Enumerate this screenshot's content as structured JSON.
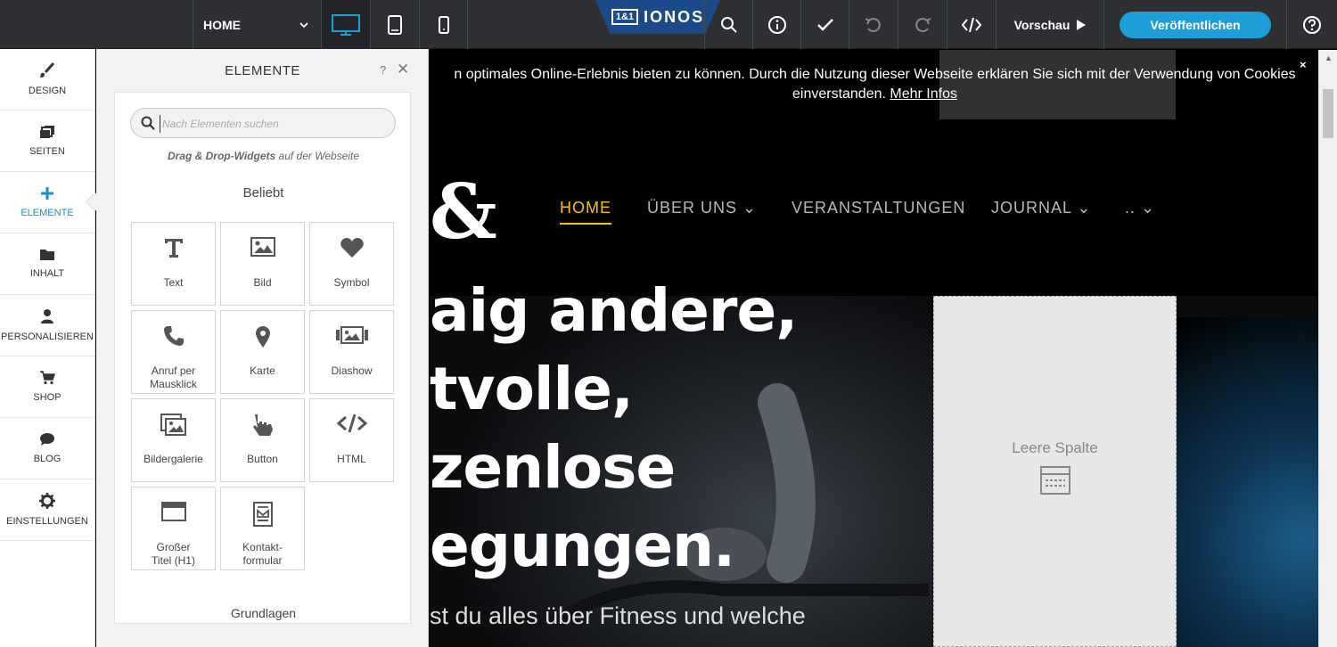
{
  "toolbar": {
    "page_select": "HOME",
    "logo_box": "1&1",
    "logo_text": "IONOS",
    "preview_label": "Vorschau",
    "publish_label": "Veröffentlichen",
    "accent": "#1e9ed6"
  },
  "leftnav": {
    "items": [
      {
        "label": "DESIGN",
        "icon": "brush-icon"
      },
      {
        "label": "SEITEN",
        "icon": "pages-icon"
      },
      {
        "label": "ELEMENTE",
        "icon": "plus-icon",
        "active": true
      },
      {
        "label": "INHALT",
        "icon": "folder-icon"
      },
      {
        "label": "PERSONALISIEREN",
        "icon": "person-icon"
      },
      {
        "label": "SHOP",
        "icon": "cart-icon"
      },
      {
        "label": "BLOG",
        "icon": "comment-icon"
      },
      {
        "label": "EINSTELLUNGEN",
        "icon": "gear-icon"
      }
    ]
  },
  "panel": {
    "title": "ELEMENTE",
    "help": "?",
    "search_placeholder": "Nach Elementen suchen",
    "hint_bold": "Drag & Drop-Widgets",
    "hint_rest": " auf der Webseite",
    "section_popular": "Beliebt",
    "section_basics": "Grundlagen",
    "widgets": [
      {
        "label": "Text",
        "icon": "text-icon"
      },
      {
        "label": "Bild",
        "icon": "image-icon"
      },
      {
        "label": "Symbol",
        "icon": "heart-icon"
      },
      {
        "label": "Anruf per Mausklick",
        "icon": "phone-icon"
      },
      {
        "label": "Karte",
        "icon": "map-pin-icon"
      },
      {
        "label": "Diashow",
        "icon": "slideshow-icon"
      },
      {
        "label": "Bildergalerie",
        "icon": "gallery-icon"
      },
      {
        "label": "Button",
        "icon": "hand-pointer-icon"
      },
      {
        "label": "HTML",
        "icon": "code-icon"
      },
      {
        "label": "Großer Titel (H1)",
        "icon": "title-icon"
      },
      {
        "label": "Kontakt-formular",
        "icon": "form-icon"
      }
    ]
  },
  "site": {
    "cookie_line1": "n optimales Online-Erlebnis bieten zu können. Durch die Nutzung dieser Webseite erklären Sie sich mit der Verwendung von Cookies",
    "cookie_line2": "einverstanden.",
    "cookie_link": "Mehr Infos",
    "cookie_close": "×",
    "nav": [
      "HOME",
      "ÜBER UNS",
      "VERANSTALTUNGEN",
      "JOURNAL",
      ".."
    ],
    "logo_fragment": "&",
    "hero": [
      "aig andere,",
      "tvolle,",
      "zenlose",
      "egungen."
    ],
    "hero_sub": "st du alles über Fitness und welche",
    "empty_column": "Leere Spalte",
    "nav_active_color": "#f7c400"
  }
}
